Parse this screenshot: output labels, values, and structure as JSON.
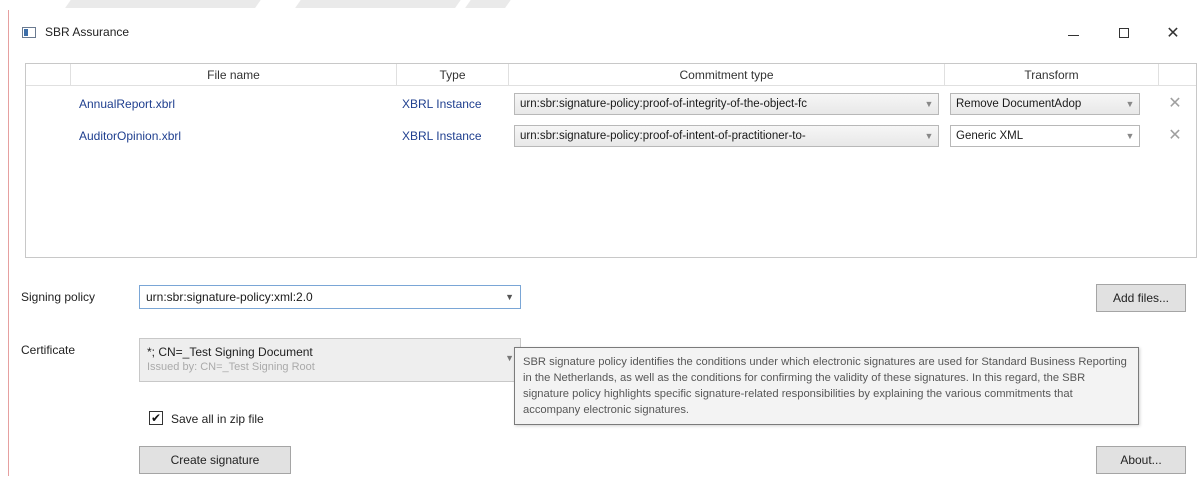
{
  "window": {
    "title": "SBR Assurance"
  },
  "table": {
    "headers": [
      "File name",
      "Type",
      "Commitment type",
      "Transform"
    ],
    "rows": [
      {
        "file_name": "AnnualReport.xbrl",
        "type": "XBRL Instance",
        "commitment": "urn:sbr:signature-policy:proof-of-integrity-of-the-object-fc",
        "transform": "Remove DocumentAdop"
      },
      {
        "file_name": "AuditorOpinion.xbrl",
        "type": "XBRL Instance",
        "commitment": "urn:sbr:signature-policy:proof-of-intent-of-practitioner-to-",
        "transform": "Generic XML"
      }
    ]
  },
  "signing_policy": {
    "label": "Signing policy",
    "value": "urn:sbr:signature-policy:xml:2.0"
  },
  "certificate": {
    "label": "Certificate",
    "value": "*; CN=_Test Signing Document",
    "issued_by": "Issued by: CN=_Test Signing Root"
  },
  "tooltip": {
    "text": "SBR signature policy identifies the conditions under which electronic signatures are used for Standard Business Reporting in the Netherlands, as well as the conditions for confirming the validity of these signatures. In this regard, the SBR signature policy highlights specific signature-related responsibilities by explaining the various commitments that accompany electronic signatures."
  },
  "options": {
    "zip_label": "Save all in zip file",
    "zip_checked": true
  },
  "buttons": {
    "add_files": "Add files...",
    "create_signature": "Create signature",
    "about": "About..."
  }
}
